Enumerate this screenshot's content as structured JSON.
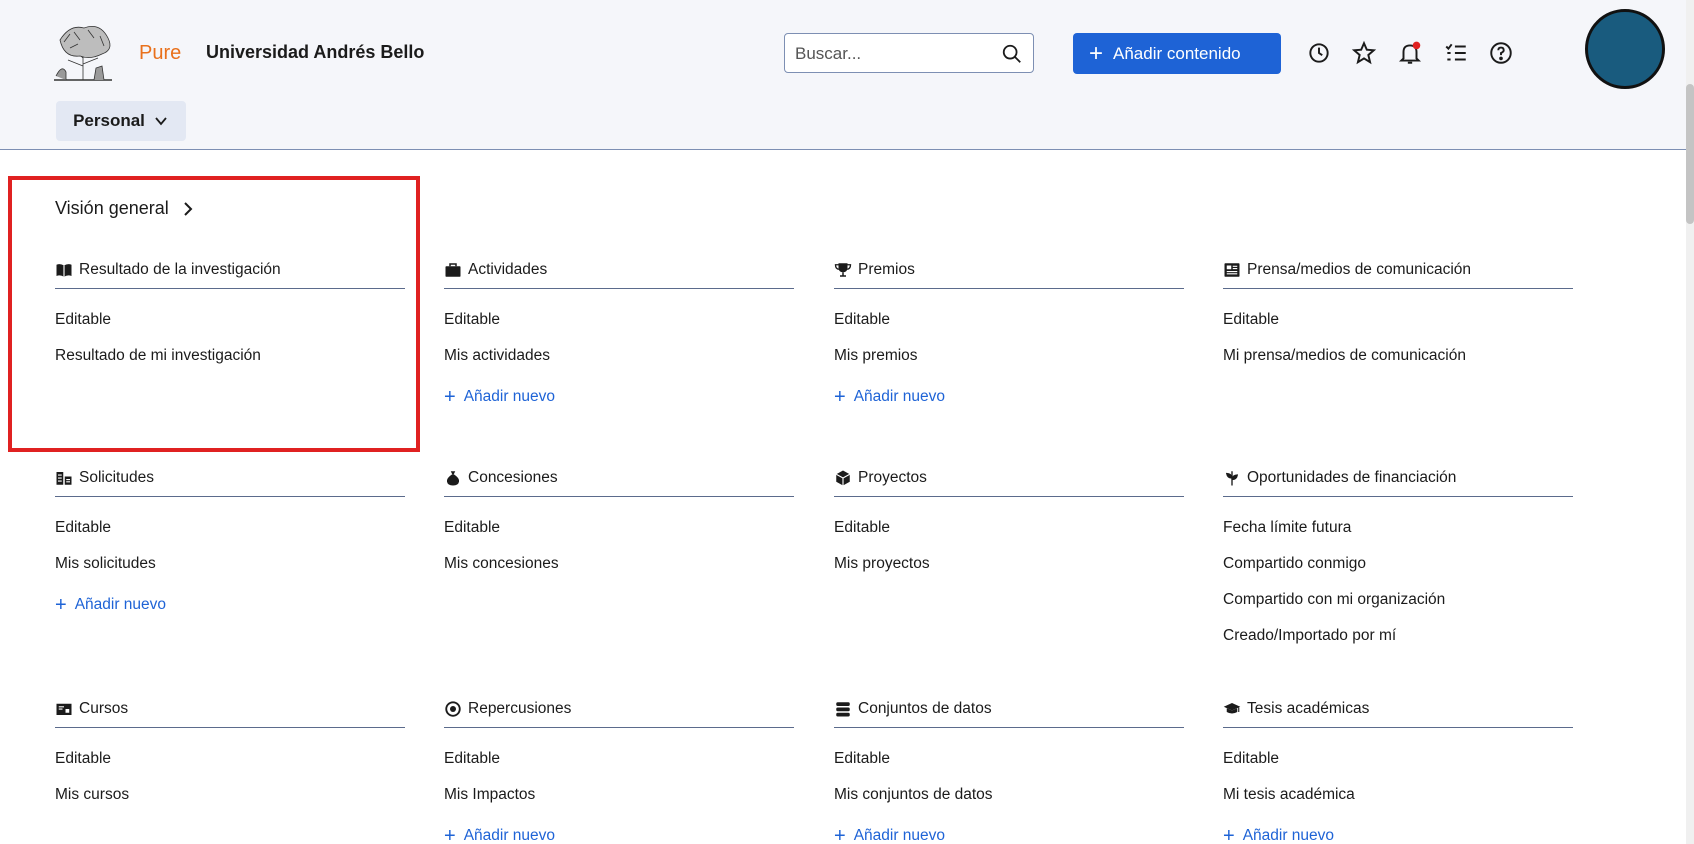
{
  "header": {
    "product": "Pure",
    "organization": "Universidad Andrés Bello",
    "search_placeholder": "Buscar...",
    "add_content_label": "Añadir contenido",
    "accent_color": "#1e63d6",
    "product_color": "#e9711c",
    "icons": [
      "history-icon",
      "star-icon",
      "bell-icon",
      "tasks-icon",
      "help-icon"
    ]
  },
  "nav": {
    "personal_label": "Personal"
  },
  "overview_label": "Visión general",
  "highlight_color": "#e02121",
  "sections": [
    {
      "title": "Resultado de la investigación",
      "icon": "book-icon",
      "links": [
        "Editable",
        "Resultado de mi investigación"
      ],
      "add_new": ""
    },
    {
      "title": "Actividades",
      "icon": "briefcase-icon",
      "links": [
        "Editable",
        "Mis actividades"
      ],
      "add_new": "Añadir nuevo"
    },
    {
      "title": "Premios",
      "icon": "trophy-icon",
      "links": [
        "Editable",
        "Mis premios"
      ],
      "add_new": "Añadir nuevo"
    },
    {
      "title": "Prensa/medios de comunicación",
      "icon": "newspaper-icon",
      "links": [
        "Editable",
        "Mi prensa/medios de comunicación"
      ],
      "add_new": ""
    },
    {
      "title": "Solicitudes",
      "icon": "applications-icon",
      "links": [
        "Editable",
        "Mis solicitudes"
      ],
      "add_new": "Añadir nuevo"
    },
    {
      "title": "Concesiones",
      "icon": "money-bag-icon",
      "links": [
        "Editable",
        "Mis concesiones"
      ],
      "add_new": ""
    },
    {
      "title": "Proyectos",
      "icon": "cube-icon",
      "links": [
        "Editable",
        "Mis proyectos"
      ],
      "add_new": ""
    },
    {
      "title": "Oportunidades de financiación",
      "icon": "sprout-icon",
      "links": [
        "Fecha límite futura",
        "Compartido conmigo",
        "Compartido con mi organización",
        "Creado/Importado por mí"
      ],
      "add_new": ""
    },
    {
      "title": "Cursos",
      "icon": "course-icon",
      "links": [
        "Editable",
        "Mis cursos"
      ],
      "add_new": ""
    },
    {
      "title": "Repercusiones",
      "icon": "target-icon",
      "links": [
        "Editable",
        "Mis Impactos"
      ],
      "add_new": "Añadir nuevo"
    },
    {
      "title": "Conjuntos de datos",
      "icon": "database-icon",
      "links": [
        "Editable",
        "Mis conjuntos de datos"
      ],
      "add_new": "Añadir nuevo"
    },
    {
      "title": "Tesis académicas",
      "icon": "graduation-cap-icon",
      "links": [
        "Editable",
        "Mi tesis académica"
      ],
      "add_new": "Añadir nuevo"
    }
  ]
}
